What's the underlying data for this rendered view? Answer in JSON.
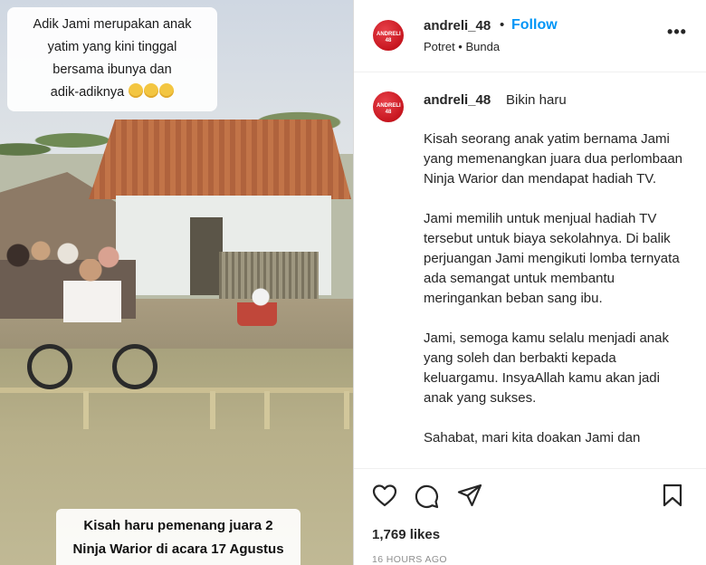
{
  "media": {
    "top_caption_lines": [
      "Adik Jami merupakan anak",
      "yatim yang kini tinggal",
      "bersama ibunya dan",
      "adik-adiknya"
    ],
    "top_caption_emoji": [
      "pleading-face",
      "pleading-face",
      "pleading-face"
    ],
    "bottom_caption_lines": [
      "Kisah haru pemenang juara 2",
      "Ninja Warior di acara 17 Agustus"
    ]
  },
  "header": {
    "username": "andreli_48",
    "separator": "•",
    "follow_label": "Follow",
    "location": "Potret • Bunda",
    "avatar_text": "ANDRELI 48",
    "more_label": "•••"
  },
  "caption": {
    "username": "andreli_48",
    "short_text": "Bikin haru",
    "paragraphs": [
      "Kisah seorang anak yatim bernama Jami yang memenangkan juara dua perlombaan Ninja Warior dan mendapat hadiah TV.",
      "Jami memilih untuk menjual hadiah TV tersebut untuk biaya sekolahnya. Di balik perjuangan Jami mengikuti lomba ternyata ada semangat untuk membantu meringankan beban sang ibu.",
      "Jami, semoga kamu selalu menjadi anak yang soleh dan berbakti kepada keluargamu. InsyaAllah kamu akan jadi anak yang sukses.",
      "Sahabat, mari kita doakan Jami dan"
    ]
  },
  "actions": {
    "icons": [
      "heart-icon",
      "comment-icon",
      "share-icon",
      "bookmark-icon"
    ],
    "likes": "1,769 likes",
    "timestamp": "16 HOURS AGO"
  },
  "colors": {
    "follow_blue": "#0095f6",
    "avatar_red": "#c7161f",
    "muted_gray": "#8e8e8e",
    "text": "#262626"
  }
}
